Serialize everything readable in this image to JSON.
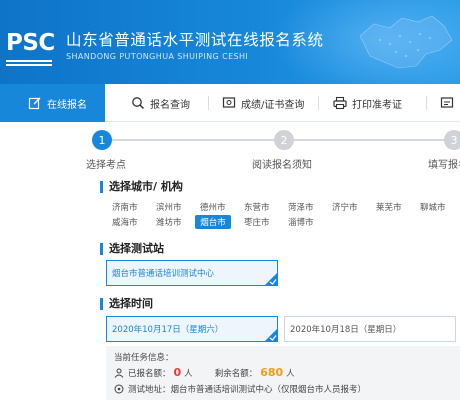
{
  "header": {
    "logo": "PSC",
    "title": "山东省普通话水平测试在线报名系统",
    "subtitle": "SHANDONG PUTONGHUA SHUIPING CESHI"
  },
  "nav": {
    "items": [
      {
        "label": "在线报名",
        "icon": "edit-icon",
        "active": true
      },
      {
        "label": "报名查询",
        "icon": "search-icon",
        "active": false
      },
      {
        "label": "成绩/证书查询",
        "icon": "certificate-icon",
        "active": false
      },
      {
        "label": "打印准考证",
        "icon": "printer-icon",
        "active": false
      }
    ]
  },
  "steps": [
    {
      "number": "1",
      "label": "选择考点",
      "active": true
    },
    {
      "number": "2",
      "label": "阅读报名须知",
      "active": false
    },
    {
      "number": "3",
      "label": "填写报名",
      "active": false
    }
  ],
  "city_section": {
    "title": "选择城市/ 机构",
    "cities_row1": [
      "济南市",
      "滨州市",
      "德州市",
      "东营市",
      "菏泽市",
      "济宁市",
      "莱芜市",
      "聊城市"
    ],
    "cities_row2": [
      "威海市",
      "潍坊市",
      "烟台市",
      "枣庄市",
      "淄博市"
    ],
    "selected": "烟台市"
  },
  "site_section": {
    "title": "选择测试站",
    "selected_site": "烟台市普通话培训测试中心"
  },
  "time_section": {
    "title": "选择时间",
    "options": [
      {
        "label": "2020年10月17日（星期六）",
        "selected": true
      },
      {
        "label": "2020年10月18日（星期日）",
        "selected": false
      }
    ]
  },
  "task_info": {
    "title": "当前任务信息：",
    "registered_label": "已报名额：",
    "registered_value": "0",
    "registered_unit": "人",
    "remaining_label": "剩余名额：",
    "remaining_value": "680",
    "remaining_unit": "人",
    "address_label": "测试地址：",
    "address_value": "烟台市普通话培训测试中心（仅限烟台市人员报考）"
  },
  "colors": {
    "accent": "#1787da",
    "registered": "#e53935",
    "remaining": "#f39c12"
  }
}
